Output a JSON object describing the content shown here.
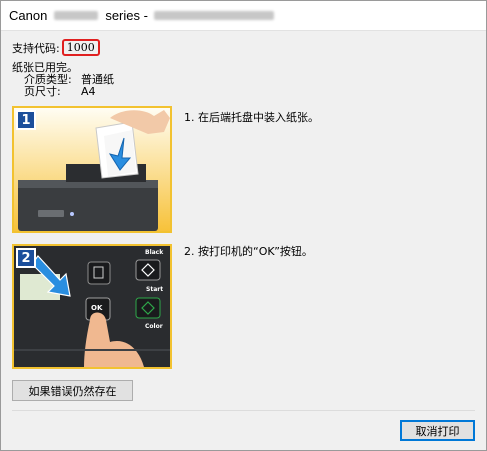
{
  "window": {
    "title_prefix": "Canon",
    "title_series": "series -"
  },
  "error": {
    "support_code_label": "支持代码:",
    "support_code": "1000",
    "message": "纸张已用完。",
    "media_type_label": "介质类型:",
    "media_type": "普通纸",
    "page_size_label": "页尺寸:",
    "page_size": "A4"
  },
  "steps": [
    {
      "number": "1",
      "text": "1.  在后端托盘中装入纸张。"
    },
    {
      "number": "2",
      "text": "2.  按打印机的“OK”按钮。"
    }
  ],
  "panel_labels": {
    "black": "Black",
    "start": "Start",
    "color": "Color",
    "ok": "OK"
  },
  "buttons": {
    "persist": "如果错误仍然存在",
    "cancel": "取消打印"
  },
  "colors": {
    "highlight_border": "#e02020",
    "image_border": "#f2c230",
    "step_badge": "#1b4e9b",
    "arrow": "#2a8ee0",
    "default_button_border": "#0078d7"
  }
}
